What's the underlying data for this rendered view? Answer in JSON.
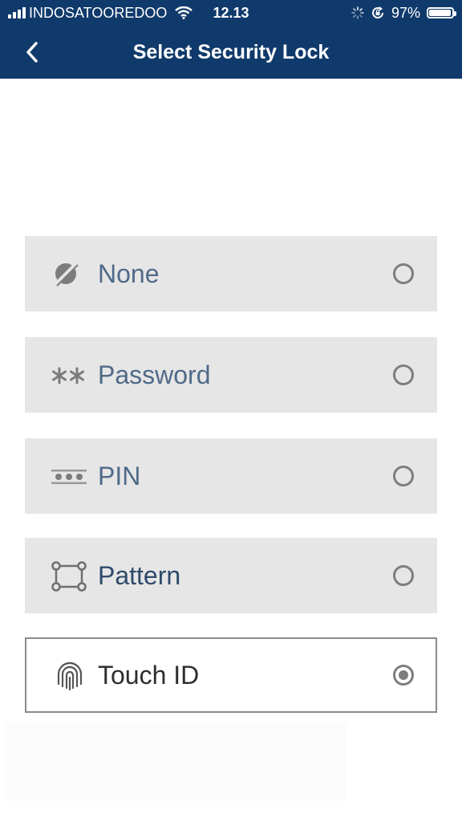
{
  "status": {
    "carrier": "INDOSATOOREDOO",
    "time": "12.13",
    "battery_percent": "97%",
    "battery_level": 0.97,
    "signal_bars": 4,
    "icons": [
      "signal-bars-icon",
      "wifi-icon",
      "activity-spinner-icon",
      "rotation-lock-icon",
      "battery-icon"
    ]
  },
  "header": {
    "title": "Select Security Lock",
    "back_icon": "chevron-left-icon"
  },
  "colors": {
    "nav_bg": "#103a6b",
    "option_bg": "#e6e6e6",
    "label_color": "#4f6a88",
    "selected_border": "#8a8a8a"
  },
  "options": [
    {
      "label": "None",
      "icon": "none-lock-icon",
      "selected": false
    },
    {
      "label": "Password",
      "icon": "password-asterisk-icon",
      "selected": false
    },
    {
      "label": "PIN",
      "icon": "pin-dots-icon",
      "selected": false
    },
    {
      "label": "Pattern",
      "icon": "pattern-grid-icon",
      "selected": false
    },
    {
      "label": "Touch ID",
      "icon": "fingerprint-icon",
      "selected": true
    }
  ]
}
